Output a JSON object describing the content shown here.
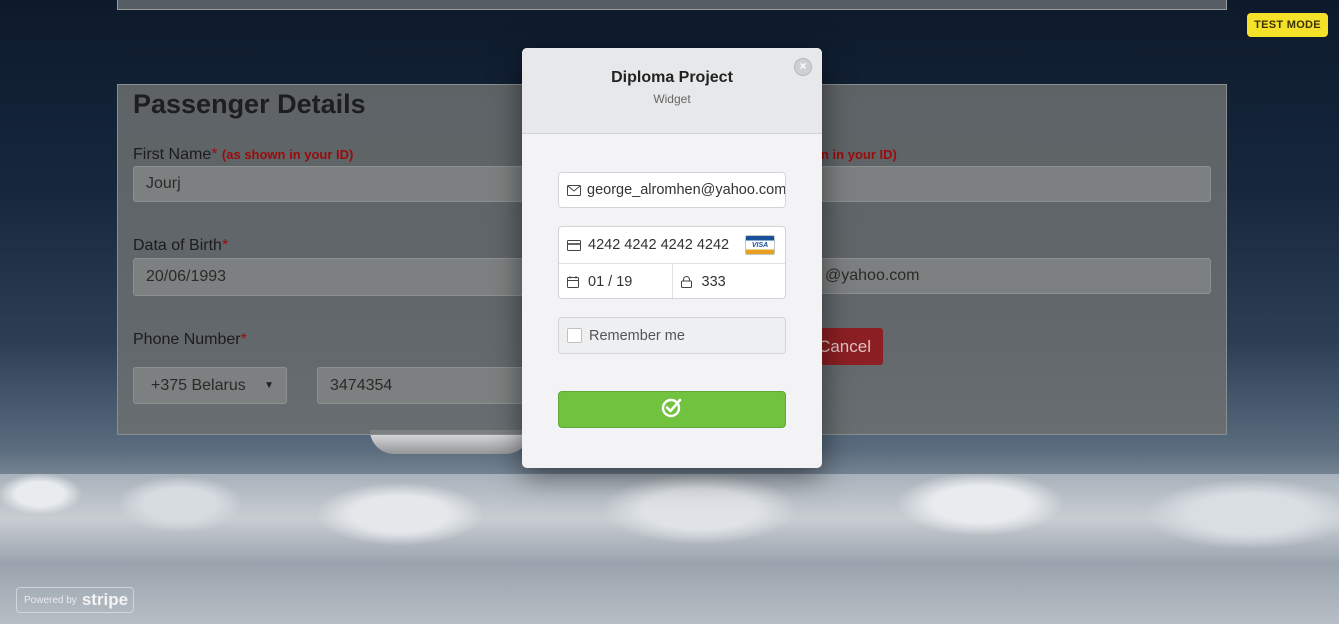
{
  "page": {
    "test_mode_label": "TEST MODE",
    "powered_by": "Powered by",
    "powered_brand": "stripe"
  },
  "form": {
    "title": "Passenger Details",
    "first_name_label": "First Name",
    "first_name_note": "(as shown in your ID)",
    "first_name_value": "Jourj",
    "last_name_note_fragment": "n in your ID)",
    "dob_label": "Data of Birth",
    "dob_value": "20/06/1993",
    "email_fragment": "@yahoo.com",
    "phone_label": "Phone Number",
    "country_code": "+375 Belarus",
    "phone_value": "3474354",
    "cancel_label": "Cancel",
    "required_mark": "*"
  },
  "modal": {
    "title": "Diploma Project",
    "subtitle": "Widget",
    "close_symbol": "×",
    "email_value": "george_alromhen@yahoo.com",
    "card_number": "4242 4242 4242 4242",
    "card_brand": "VISA",
    "expiry": "01 / 19",
    "cvc": "333",
    "remember_label": "Remember me"
  },
  "colors": {
    "pay_button": "#71c33f",
    "test_mode": "#f5e12a",
    "cancel": "#8c1f23",
    "required": "#9a0b0b"
  },
  "icons": [
    "envelope-icon",
    "credit-card-icon",
    "calendar-icon",
    "lock-icon",
    "checkmark-circle-icon",
    "close-icon",
    "chevron-down-icon",
    "visa-icon"
  ]
}
